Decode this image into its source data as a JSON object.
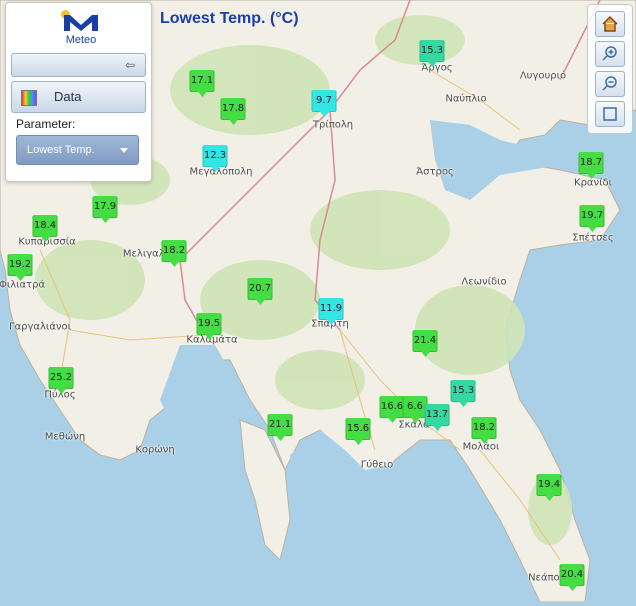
{
  "title": "Lowest Temp. (°C)",
  "logo": {
    "text": "Meteo"
  },
  "panel": {
    "data_label": "Data",
    "parameter_label": "Parameter:",
    "parameter_value": "Lowest Temp."
  },
  "tools": [
    "home-icon",
    "zoom-in-icon",
    "zoom-out-icon",
    "full-extent-icon"
  ],
  "colors": {
    "warm": "#44dd44",
    "mid": "#33d9a0",
    "cool": "#33e6e6",
    "sea": "#a9d0e6",
    "land": "#f2efe6"
  },
  "places": [
    {
      "name": "Άργος"
    },
    {
      "name": "Λυγουριό"
    },
    {
      "name": "Ναύπλιο"
    },
    {
      "name": "Τρίπολη"
    },
    {
      "name": "Μεγαλόπολη"
    },
    {
      "name": "Άστρος"
    },
    {
      "name": "Κρανίδι"
    },
    {
      "name": "Σπέτσες"
    },
    {
      "name": "Κυπαρισσία"
    },
    {
      "name": "Μελιγαλάς"
    },
    {
      "name": "Φιλιατρά"
    },
    {
      "name": "Γαργαλιάνοι"
    },
    {
      "name": "Λεωνίδιο"
    },
    {
      "name": "Σπάρτη"
    },
    {
      "name": "Καλαμάτα"
    },
    {
      "name": "Πύλος"
    },
    {
      "name": "Μεθώνη"
    },
    {
      "name": "Κορώνη"
    },
    {
      "name": "Σκάλα"
    },
    {
      "name": "Μολάοι"
    },
    {
      "name": "Γύθειο"
    },
    {
      "name": "Νεάπολη"
    }
  ],
  "markers": [
    {
      "value": "15.3",
      "tone": "mid"
    },
    {
      "value": "17.1",
      "tone": "warm"
    },
    {
      "value": "17.8",
      "tone": "warm"
    },
    {
      "value": "9.7",
      "tone": "cool"
    },
    {
      "value": "12.3",
      "tone": "cool"
    },
    {
      "value": "18.7",
      "tone": "warm"
    },
    {
      "value": "19.7",
      "tone": "warm"
    },
    {
      "value": "17.9",
      "tone": "warm"
    },
    {
      "value": "18.4",
      "tone": "warm"
    },
    {
      "value": "18.2",
      "tone": "warm"
    },
    {
      "value": "19.2",
      "tone": "warm"
    },
    {
      "value": "20.7",
      "tone": "warm"
    },
    {
      "value": "19.5",
      "tone": "warm"
    },
    {
      "value": "11.9",
      "tone": "cool"
    },
    {
      "value": "21.4",
      "tone": "warm"
    },
    {
      "value": "25.2",
      "tone": "warm"
    },
    {
      "value": "15.3",
      "tone": "mid"
    },
    {
      "value": "16.6",
      "tone": "warm"
    },
    {
      "value": "6.6",
      "tone": "warm"
    },
    {
      "value": "13.7",
      "tone": "mid"
    },
    {
      "value": "18.2",
      "tone": "warm"
    },
    {
      "value": "21.1",
      "tone": "warm"
    },
    {
      "value": "15.6",
      "tone": "warm"
    },
    {
      "value": "19.4",
      "tone": "warm"
    },
    {
      "value": "20.4",
      "tone": "warm"
    }
  ]
}
